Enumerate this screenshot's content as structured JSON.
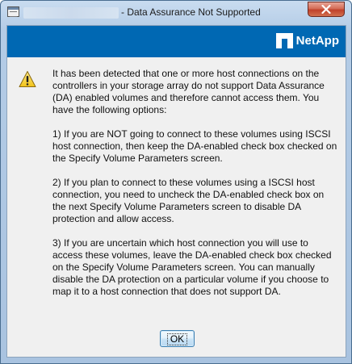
{
  "window": {
    "title": "- Data Assurance Not Supported",
    "icon": "app-window-icon",
    "close_icon": "close-icon"
  },
  "banner": {
    "brand": "NetApp",
    "brand_color": "#0068b3"
  },
  "dialog": {
    "icon": "warning-icon",
    "paragraphs": [
      "It has been detected that one or more host connections on the controllers in your storage array do not support Data Assurance (DA) enabled volumes and therefore cannot access them. You have the following options:",
      "1) If you are NOT going to connect to these volumes using ISCSI host connection, then keep the DA-enabled check box checked on the Specify Volume Parameters screen.",
      "2) If you plan to connect to these volumes using a ISCSI host connection, you need to uncheck the DA-enabled check box on the next Specify Volume Parameters screen to disable DA protection and allow access.",
      "3) If you are uncertain which host connection you will use to access these volumes, leave the DA-enabled check box checked on the Specify Volume Parameters screen. You can manually disable the DA protection on a particular volume if you choose to map it to a host connection that does not support DA."
    ],
    "ok_label": "OK"
  }
}
